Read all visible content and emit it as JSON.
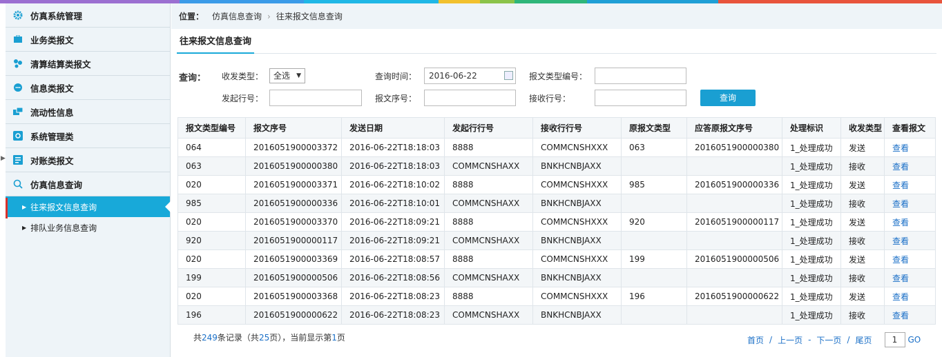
{
  "colors": {
    "accent": "#18a9d9",
    "link": "#1a6fc7"
  },
  "sidebar": {
    "groups": [
      {
        "label": "仿真系统管理",
        "icon": "gear-icon"
      },
      {
        "label": "业务类报文",
        "icon": "briefcase-icon"
      },
      {
        "label": "清算结算类报文",
        "icon": "cluster-icon"
      },
      {
        "label": "信息类报文",
        "icon": "chat-icon"
      },
      {
        "label": "流动性信息",
        "icon": "windows-icon"
      },
      {
        "label": "系统管理类",
        "icon": "settings-box-icon"
      },
      {
        "label": "对账类报文",
        "icon": "ledger-icon"
      },
      {
        "label": "仿真信息查询",
        "icon": "search-icon"
      }
    ],
    "subitems": [
      {
        "label": "往来报文信息查询"
      },
      {
        "label": "排队业务信息查询"
      }
    ]
  },
  "breadcrumb": {
    "prefix": "位置：",
    "item1": "仿真信息查询",
    "item2": "往来报文信息查询"
  },
  "page_title": "往来报文信息查询",
  "query": {
    "title": "查询：",
    "type_label": "收发类型：",
    "type_value": "全选",
    "time_label": "查询时间：",
    "time_value": "2016-06-22",
    "msgtype_label": "报文类型编号：",
    "sender_label": "发起行号：",
    "seq_label": "报文序号：",
    "receiver_label": "接收行号：",
    "button": "查询"
  },
  "table": {
    "headers": [
      "报文类型编号",
      "报文序号",
      "发送日期",
      "发起行行号",
      "接收行行号",
      "原报文类型",
      "应答原报文序号",
      "处理标识",
      "收发类型",
      "查看报文"
    ],
    "rows": [
      [
        "064",
        "2016051900003372",
        "2016-06-22T18:18:03",
        "8888",
        "COMMCNSHXXX",
        "063",
        "2016051900000380",
        "1_处理成功",
        "发送",
        "查看"
      ],
      [
        "063",
        "2016051900000380",
        "2016-06-22T18:18:03",
        "COMMCNSHAXX",
        "BNKHCNBJAXX",
        "",
        "",
        "1_处理成功",
        "接收",
        "查看"
      ],
      [
        "020",
        "2016051900003371",
        "2016-06-22T18:10:02",
        "8888",
        "COMMCNSHXXX",
        "985",
        "2016051900000336",
        "1_处理成功",
        "发送",
        "查看"
      ],
      [
        "985",
        "2016051900000336",
        "2016-06-22T18:10:01",
        "COMMCNSHAXX",
        "BNKHCNBJAXX",
        "",
        "",
        "1_处理成功",
        "接收",
        "查看"
      ],
      [
        "020",
        "2016051900003370",
        "2016-06-22T18:09:21",
        "8888",
        "COMMCNSHXXX",
        "920",
        "2016051900000117",
        "1_处理成功",
        "发送",
        "查看"
      ],
      [
        "920",
        "2016051900000117",
        "2016-06-22T18:09:21",
        "COMMCNSHAXX",
        "BNKHCNBJAXX",
        "",
        "",
        "1_处理成功",
        "接收",
        "查看"
      ],
      [
        "020",
        "2016051900003369",
        "2016-06-22T18:08:57",
        "8888",
        "COMMCNSHXXX",
        "199",
        "2016051900000506",
        "1_处理成功",
        "发送",
        "查看"
      ],
      [
        "199",
        "2016051900000506",
        "2016-06-22T18:08:56",
        "COMMCNSHAXX",
        "BNKHCNBJAXX",
        "",
        "",
        "1_处理成功",
        "接收",
        "查看"
      ],
      [
        "020",
        "2016051900003368",
        "2016-06-22T18:08:23",
        "8888",
        "COMMCNSHXXX",
        "196",
        "2016051900000622",
        "1_处理成功",
        "发送",
        "查看"
      ],
      [
        "196",
        "2016051900000622",
        "2016-06-22T18:08:23",
        "COMMCNSHAXX",
        "BNKHCNBJAXX",
        "",
        "",
        "1_处理成功",
        "接收",
        "查看"
      ]
    ]
  },
  "footer": {
    "p1": "共",
    "total": "249",
    "p2": "条记录（共",
    "pages": "25",
    "p3": "页），当前显示第",
    "current": "1",
    "p4": "页"
  },
  "pager": {
    "first": "首页",
    "prev": "上一页",
    "next": "下一页",
    "last": "尾页",
    "sep1": "/",
    "sep2": "-",
    "sep3": "/",
    "page": "1",
    "go": "GO"
  }
}
